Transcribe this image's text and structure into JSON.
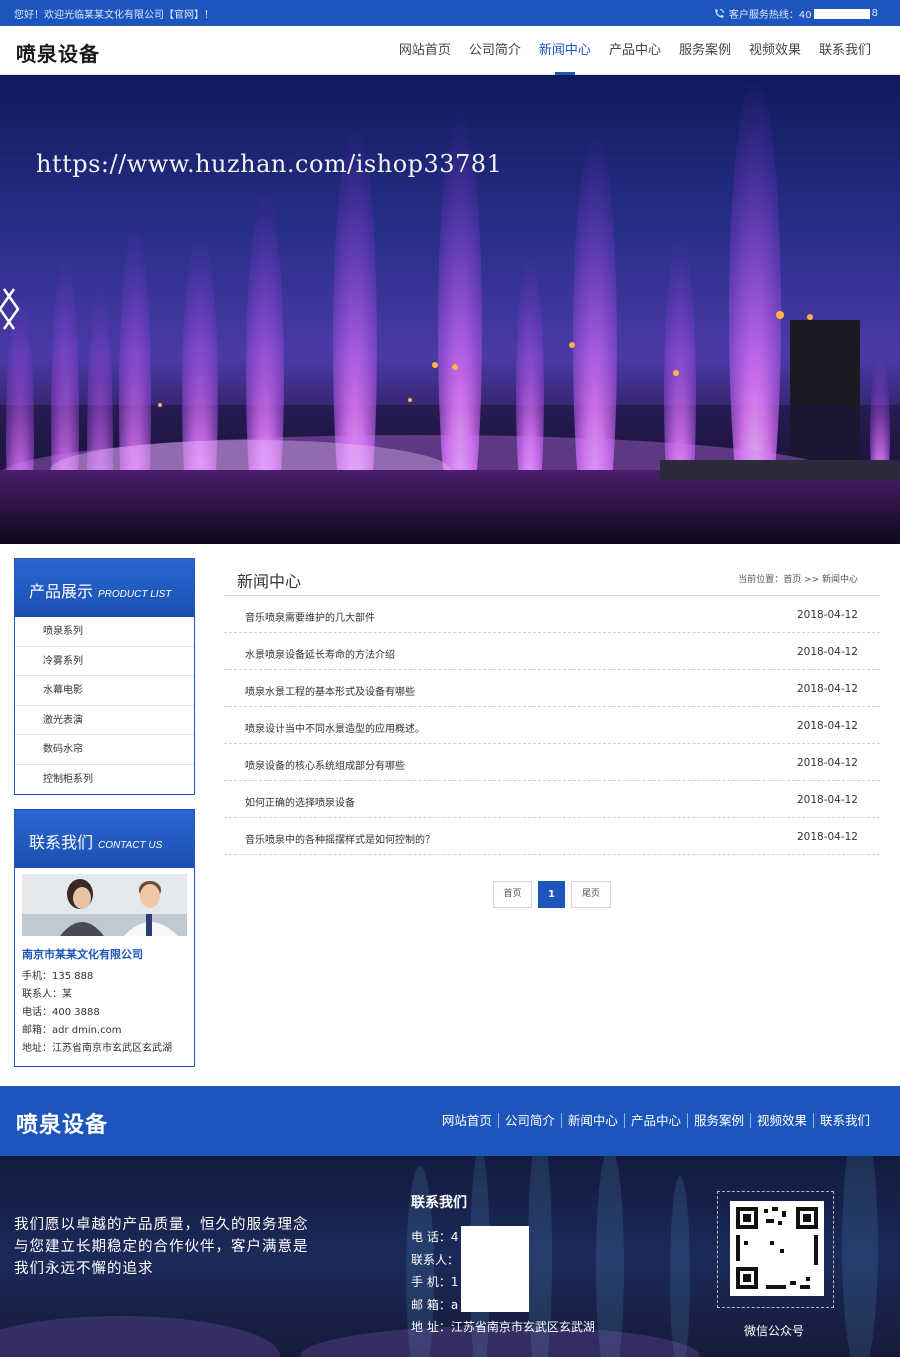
{
  "topbar": {
    "welcome": "您好！欢迎光临某某文化有限公司【官网】！",
    "hotline_label": "客户服务热线：40",
    "hotline_tail": "8"
  },
  "header": {
    "logo": "喷泉设备",
    "nav": [
      "网站首页",
      "公司简介",
      "新闻中心",
      "产品中心",
      "服务案例",
      "视频效果",
      "联系我们"
    ],
    "active_nav": "新闻中心"
  },
  "banner": {
    "watermark": "https://www.huzhan.com/ishop33781"
  },
  "sidebar": {
    "products": {
      "title_cn": "产品展示",
      "title_en": "PRODUCT LIST",
      "items": [
        "喷泉系列",
        "冷雾系列",
        "水幕电影",
        "激光表演",
        "数码水帘",
        "控制柜系列"
      ]
    },
    "contact": {
      "title_cn": "联系我们",
      "title_en": "CONTACT US",
      "company": "南京市某某文化有限公司",
      "lines": [
        "手机：135          888",
        "联系人：某",
        "电话：400          3888",
        "邮箱：adr          dmin.com",
        "地址：江苏省南京市玄武区玄武湖"
      ]
    }
  },
  "news": {
    "title": "新闻中心",
    "breadcrumb": "当前位置：首页 >> 新闻中心",
    "items": [
      {
        "title": "音乐喷泉需要维护的几大部件",
        "date": "2018-04-12"
      },
      {
        "title": "水景喷泉设备延长寿命的方法介绍",
        "date": "2018-04-12"
      },
      {
        "title": "喷泉水景工程的基本形式及设备有哪些",
        "date": "2018-04-12"
      },
      {
        "title": "喷泉设计当中不同水景造型的应用概述。",
        "date": "2018-04-12"
      },
      {
        "title": "喷泉设备的核心系统组成部分有哪些",
        "date": "2018-04-12"
      },
      {
        "title": "如何正确的选择喷泉设备",
        "date": "2018-04-12"
      },
      {
        "title": "音乐喷泉中的各种摇摆样式是如何控制的？",
        "date": "2018-04-12"
      }
    ],
    "pager": {
      "first": "首页",
      "current": "1",
      "last": "尾页"
    }
  },
  "footer": {
    "logo": "喷泉设备",
    "nav": [
      "网站首页",
      "公司简介",
      "新闻中心",
      "产品中心",
      "服务案例",
      "视频效果",
      "联系我们"
    ],
    "slogan": "我们愿以卓越的产品质量，恒久的服务理念与您建立长期稳定的合作伙伴，客户满意是我们永远不懈的追求",
    "contact_title": "联系我们",
    "contact_lines": [
      "电 话：4           8",
      "联系人：",
      "手 机：1           8",
      "邮 箱：a                   n.com",
      "地 址：江苏省南京市玄武区玄武湖"
    ],
    "qr_label": "微信公众号"
  },
  "colors": {
    "brand": "#1c56bd",
    "accent_text": "#1c56bd"
  }
}
